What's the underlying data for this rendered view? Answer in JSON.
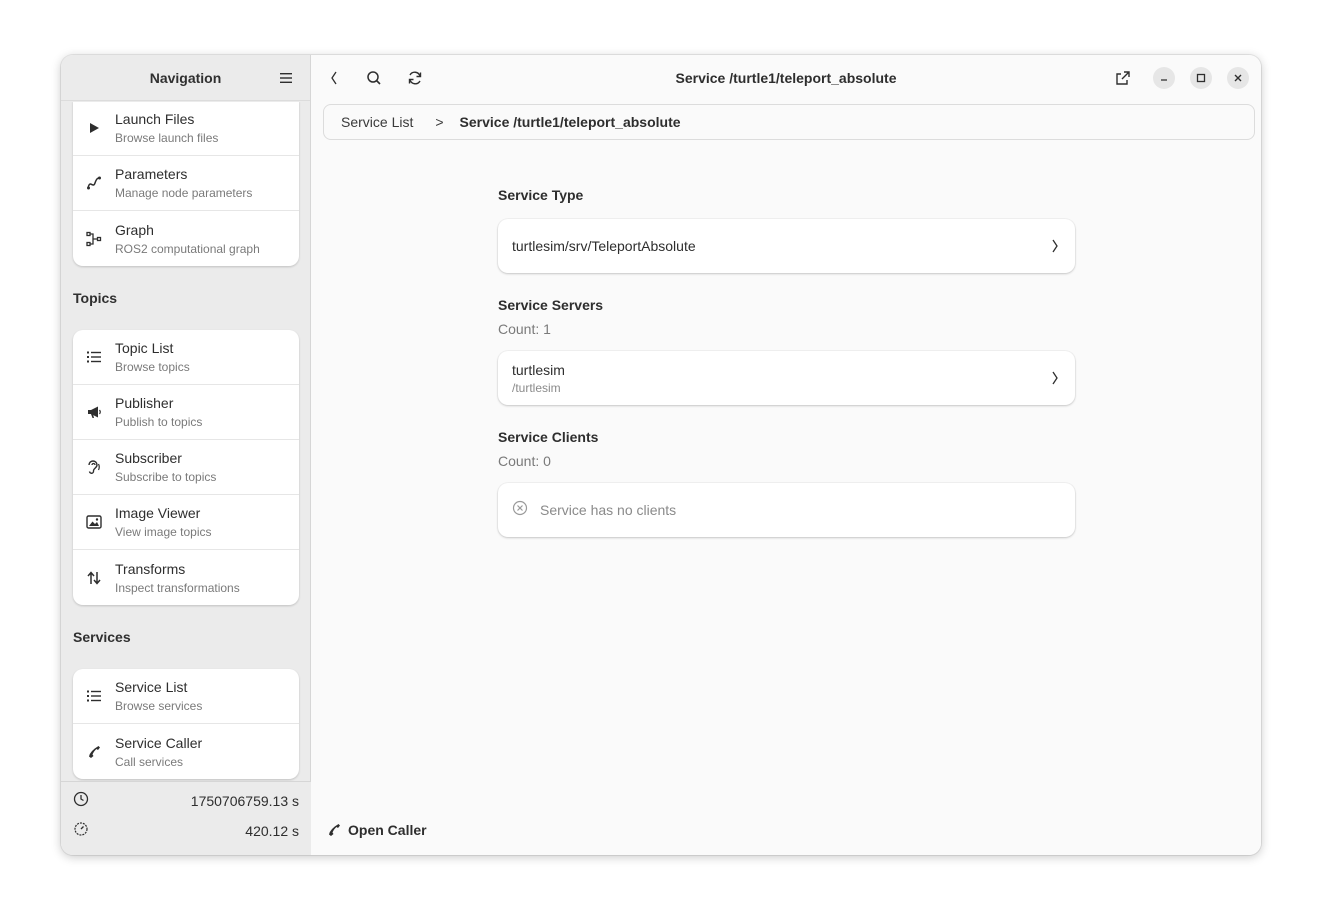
{
  "sidebar": {
    "title": "Navigation",
    "top_items": [
      {
        "title": "Launch Files",
        "subtitle": "Browse launch files",
        "icon": "play-icon"
      },
      {
        "title": "Parameters",
        "subtitle": "Manage node parameters",
        "icon": "parameters-icon"
      },
      {
        "title": "Graph",
        "subtitle": "ROS2 computational graph",
        "icon": "graph-icon"
      }
    ],
    "topics_title": "Topics",
    "topics": [
      {
        "title": "Topic List",
        "subtitle": "Browse topics",
        "icon": "list-icon"
      },
      {
        "title": "Publisher",
        "subtitle": "Publish to topics",
        "icon": "megaphone-icon"
      },
      {
        "title": "Subscriber",
        "subtitle": "Subscribe to topics",
        "icon": "ear-icon"
      },
      {
        "title": "Image Viewer",
        "subtitle": "View image topics",
        "icon": "image-icon"
      },
      {
        "title": "Transforms",
        "subtitle": "Inspect transformations",
        "icon": "transform-arrows-icon"
      }
    ],
    "services_title": "Services",
    "services": [
      {
        "title": "Service List",
        "subtitle": "Browse services",
        "icon": "list-icon"
      },
      {
        "title": "Service Caller",
        "subtitle": "Call services",
        "icon": "phone-icon"
      }
    ],
    "footer": {
      "wall_time": "1750706759.13 s",
      "elapsed_time": "420.12 s"
    }
  },
  "header": {
    "title": "Service /turtle1/teleport_absolute"
  },
  "breadcrumb": {
    "root": "Service List",
    "separator": ">",
    "current": "Service /turtle1/teleport_absolute"
  },
  "service": {
    "type_heading": "Service Type",
    "type_value": "turtlesim/srv/TeleportAbsolute",
    "servers_heading": "Service Servers",
    "servers_count": "Count: 1",
    "servers": [
      {
        "name": "turtlesim",
        "path": "/turtlesim"
      }
    ],
    "clients_heading": "Service Clients",
    "clients_count": "Count: 0",
    "clients_empty": "Service has no clients"
  },
  "actions": {
    "open_caller": "Open Caller"
  },
  "colors": {
    "sidebar_bg": "#ebebeb",
    "content_bg": "#fafafa",
    "card_bg": "#ffffff",
    "muted_text": "#7a7a7a"
  }
}
